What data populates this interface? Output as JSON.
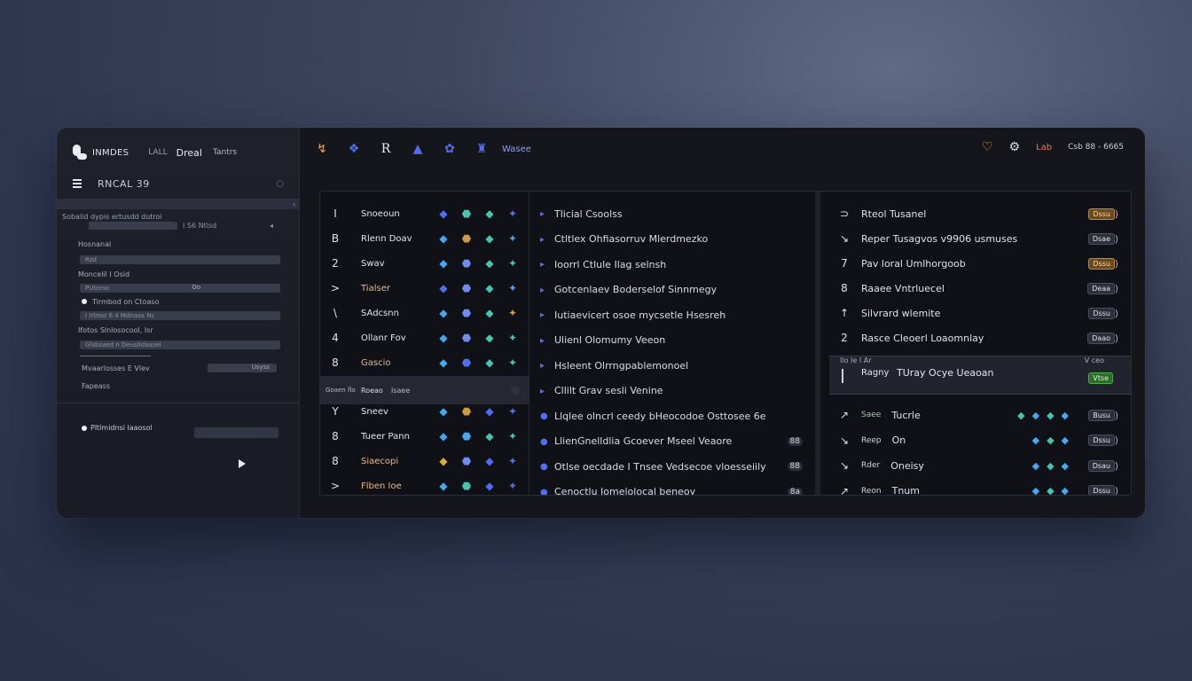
{
  "brand": {
    "name": "INMDES",
    "sub1": "LALL",
    "sub2": "Dreal",
    "sub3": "Tantrs"
  },
  "left": {
    "title": "RNCAL 39",
    "divider_label": "Sobalid dypis ertusdd dutroi",
    "divider_value": "I S6 Ntlsd",
    "fields": [
      {
        "label": "Hosnanal",
        "bar_text": "Rzd",
        "bar_value": ""
      },
      {
        "label": "Moncelil I Osid",
        "bar_text": "PUtorso",
        "bar_value": "Oo"
      },
      {
        "label": "Tirmbod on Ctoaso",
        "bar_text": "I Irtnso 6 4 Mdnasa Nc",
        "bar_value": ""
      },
      {
        "label": "Ifotos Slnlosocool, Isr",
        "bar_text": "Glsbsaed n Deuslldaasel",
        "bar_value": ""
      },
      {
        "label": "Mvaarlosses E Vlev",
        "bar_text": "",
        "bar_value": "Usyss"
      },
      {
        "label": "Fapeass",
        "bar_text": "",
        "bar_value": ""
      }
    ],
    "bottom_option": "Pltlmidnsi laaosol"
  },
  "toolbar": {
    "label": "Wasee",
    "status": "Csb 88 - 6665",
    "tag": "Lab"
  },
  "table": {
    "col1": [
      {
        "num": "I",
        "name": "Snoeoun"
      },
      {
        "num": "B",
        "name": "Rlenn Doav"
      },
      {
        "num": "2",
        "name": "Swav"
      },
      {
        "num": ">",
        "name": "Tialser"
      },
      {
        "num": "\\",
        "name": "SAdcsnn"
      },
      {
        "num": "4",
        "name": "Ollanr Fov"
      },
      {
        "num": "8",
        "name": "Gascio"
      },
      {
        "num": "Y",
        "name": "Sneev"
      },
      {
        "num": "8",
        "name": "Tueer Pann"
      },
      {
        "num": "8",
        "name": "Siaecopi"
      },
      {
        "num": ">",
        "name": "Flben Ioe"
      }
    ],
    "col1_highlight": {
      "a": "Goaen flo",
      "b": "Roeao",
      "c": "Isaee"
    },
    "col2": [
      {
        "text": "Tlicial Csoolss",
        "badge": ""
      },
      {
        "text": "Ctltlex Ohfiasorruv Mlerdmezko",
        "badge": ""
      },
      {
        "text": "Ioorrl Ctlule Ilag selnsh",
        "badge": ""
      },
      {
        "text": "Gotcenlaev Boderselof Sinnmegy",
        "badge": ""
      },
      {
        "text": "Iutiaevicert osoe mycsetle Hsesreh",
        "badge": ""
      },
      {
        "text": "Ulienl Olomumy Veeon",
        "badge": ""
      },
      {
        "text": "Hsleent Olrrngpablemonoel",
        "badge": ""
      },
      {
        "text": "Cllilt Grav sesli Venine",
        "badge": ""
      },
      {
        "text": "Llqlee olncrl ceedy bHeocodoe Osttosee 6e",
        "badge": ""
      },
      {
        "text": "LlienGnelldlia Gcoever Mseel Veaore",
        "badge": "88"
      },
      {
        "text": "Otlse oecdade I Tnsee Vedsecoe vloesseiily",
        "badge": "88"
      },
      {
        "text": "Cenoctlu Iomelolocal beneoy",
        "badge": "8a"
      }
    ],
    "col3": [
      {
        "mark": "⊃",
        "text": "Rteol Tusanel",
        "pill": "Dssu",
        "style": "orange"
      },
      {
        "mark": "↘",
        "text": "Reper Tusagvos v9906 usmuses",
        "pill": "Dsae",
        "style": ""
      },
      {
        "mark": "7",
        "text": "Pav loral Umlhorgoob",
        "pill": "Dssu",
        "style": "orange"
      },
      {
        "mark": "8",
        "text": "Raaee Vntrluecel",
        "pill": "Deaa",
        "style": ""
      },
      {
        "mark": "↑",
        "text": "Silvrard wlemite",
        "pill": "Dssu",
        "style": ""
      },
      {
        "mark": "2",
        "text": "Rasce Cleoerl Loaomnlay",
        "pill": "Daao",
        "style": ""
      },
      {
        "mark": "↗",
        "text": "Tucrle",
        "pill": "Busu",
        "style": ""
      },
      {
        "mark": "↘",
        "text": "On",
        "pill": "Dssu",
        "style": ""
      },
      {
        "mark": "↘",
        "text": "Oneisy",
        "pill": "Dsau",
        "style": ""
      },
      {
        "mark": "↗",
        "text": "Tnum",
        "pill": "Dssu",
        "style": ""
      }
    ],
    "col3_prefix": [
      "",
      "",
      "",
      "",
      "",
      "",
      "Saee",
      "Reep",
      "Rder",
      "Reon"
    ],
    "col3_highlight": {
      "head_left": "Ilo Ie I Ar",
      "head_right": "V ceo",
      "label": "Ragny",
      "title": "TUray Ocye Ueaoan",
      "pill": "Vtse"
    }
  },
  "colors": {
    "accent_blue": "#4f6ef0",
    "accent_orange": "#f0a45a",
    "accent_green": "#4fae4f",
    "accent_red": "#e57a66"
  }
}
